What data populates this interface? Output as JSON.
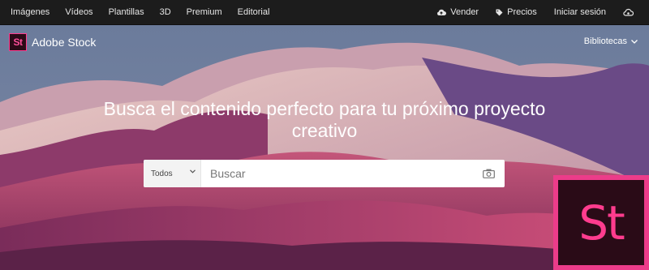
{
  "topnav": {
    "links": [
      "Imágenes",
      "Vídeos",
      "Plantillas",
      "3D",
      "Premium",
      "Editorial"
    ],
    "sell_label": "Vender",
    "pricing_label": "Precios",
    "signin_label": "Iniciar sesión"
  },
  "brand": {
    "logo_text": "St",
    "name": "Adobe Stock"
  },
  "libraries_label": "Bibliotecas",
  "hero": {
    "headline_line1": "Busca el contenido perfecto para tu próximo proyecto",
    "headline_line2": "creativo"
  },
  "search": {
    "category_selected": "Todos",
    "placeholder": "Buscar"
  },
  "overlay_logo_text": "St",
  "colors": {
    "accent": "#ff3c8e",
    "nav_bg": "#1c1c1c",
    "logo_bg": "#2a0b17"
  },
  "icons": {
    "sell": "upload-cloud-icon",
    "pricing": "tag-icon",
    "signin_extra": "cloud-sync-icon",
    "libraries": "chevron-down-icon",
    "category": "chevron-down-icon",
    "visual_search": "camera-icon"
  }
}
